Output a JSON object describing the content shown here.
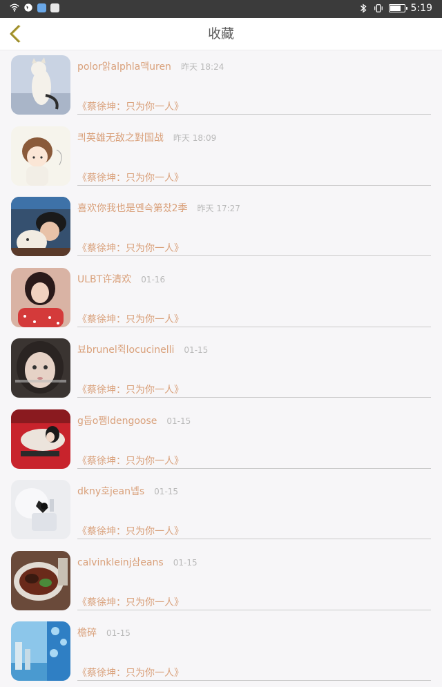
{
  "status_bar": {
    "time": "5:19"
  },
  "header": {
    "title": "收藏"
  },
  "items": [
    {
      "name": "polor앍alphla맥uren",
      "time": "昨天 18:24",
      "song": "《蔡徐坤：只为你一人》",
      "avatar": "cat-photo"
    },
    {
      "name": "킈英雄无敌之對国战",
      "time": "昨天 18:09",
      "song": "《蔡徐坤：只为你一人》",
      "avatar": "cartoon-child"
    },
    {
      "name": "喜欢你我也是옌슥第찼2季",
      "time": "昨天 17:27",
      "song": "《蔡徐坤：只为你一人》",
      "avatar": "girl-with-dog"
    },
    {
      "name": "ULBT许清欢",
      "time": "01-16",
      "song": "《蔡徐坤：只为你一人》",
      "avatar": "girl-red-dress"
    },
    {
      "name": "뵤brunel쥑locucinelli",
      "time": "01-15",
      "song": "《蔡徐坤：只为你一人》",
      "avatar": "girl-portrait"
    },
    {
      "name": "g둡o쨈ldengoose",
      "time": "01-15",
      "song": "《蔡徐坤：只为你一人》",
      "avatar": "girl-red-sofa"
    },
    {
      "name": "dkny호jean넵s",
      "time": "01-15",
      "song": "《蔡徐坤：只为你一人》",
      "avatar": "perfume-bottle"
    },
    {
      "name": "calvinkleinj삼eans",
      "time": "01-15",
      "song": "《蔡徐坤：只为你一人》",
      "avatar": "food-plate"
    },
    {
      "name": "檐碎",
      "time": "01-15",
      "song": "《蔡徐坤：只为你一人》",
      "avatar": "blue-scenery"
    }
  ]
}
